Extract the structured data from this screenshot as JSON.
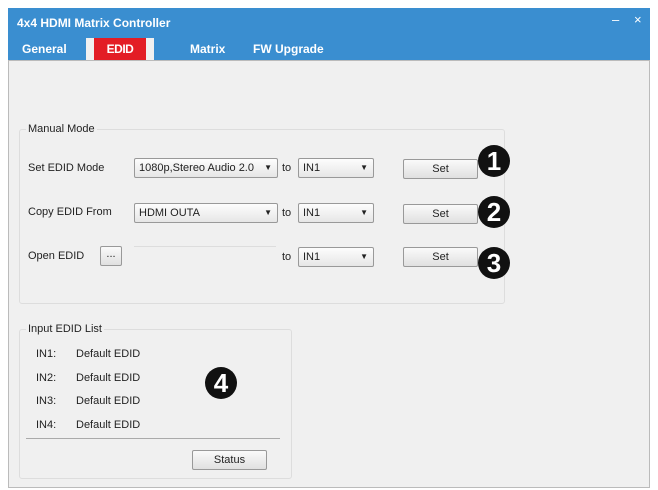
{
  "window": {
    "title": "4x4 HDMI Matrix Controller",
    "minimize": "–",
    "close": "×"
  },
  "tabs": [
    {
      "label": "General"
    },
    {
      "label": "EDID"
    },
    {
      "label": "Matrix"
    },
    {
      "label": "FW Upgrade"
    }
  ],
  "manual": {
    "title": "Manual Mode",
    "row1": {
      "label": "Set EDID Mode",
      "source": "1080p,Stereo Audio 2.0",
      "to": "to",
      "target": "IN1",
      "button": "Set",
      "callout": "1"
    },
    "row2": {
      "label": "Copy EDID From",
      "source": "HDMI OUTA",
      "to": "to",
      "target": "IN1",
      "button": "Set",
      "callout": "2"
    },
    "row3": {
      "label": "Open EDID",
      "browse": "...",
      "path": "",
      "to": "to",
      "target": "IN1",
      "button": "Set",
      "callout": "3"
    }
  },
  "list": {
    "title": "Input EDID List",
    "items": [
      {
        "input": "IN1:",
        "value": "Default EDID"
      },
      {
        "input": "IN2:",
        "value": "Default EDID"
      },
      {
        "input": "IN3:",
        "value": "Default EDID"
      },
      {
        "input": "IN4:",
        "value": "Default EDID"
      }
    ],
    "button": "Status",
    "callout": "4"
  },
  "icons": {
    "dropdown": "▼"
  }
}
